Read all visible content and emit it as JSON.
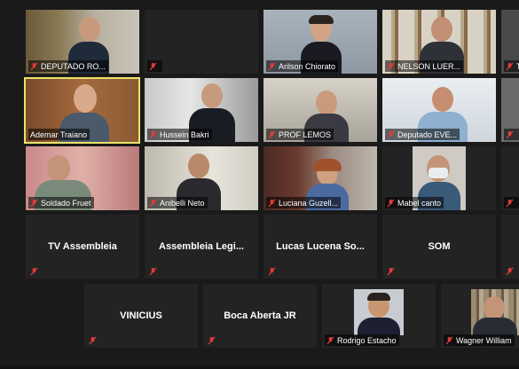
{
  "window": {
    "title": ""
  },
  "icons": {
    "mic": "mic-muted-icon"
  },
  "colors": {
    "active_border": "#e9e36a",
    "muted": "#e23b3b",
    "tile_bg": "#232323"
  },
  "participants": {
    "r1": [
      "DEPUTADO RO...",
      "",
      "Arilson Chiorato",
      "NELSON LUER...",
      "T"
    ],
    "r2": [
      "Ademar Traiano",
      "Hussein Bakri",
      "PROF LEMOS",
      "Deputado EVE...",
      ""
    ],
    "r3": [
      "Soldado Fruet",
      "Anibelli Neto",
      "Luciana Guzell...",
      "Mabel canto",
      ""
    ],
    "r4": [
      "TV Assembleia",
      "Assembleia Legi...",
      "Lucas Lucena So...",
      "SOM",
      ""
    ],
    "r5": [
      "VINICIUS",
      "Boca Aberta JR",
      "Rodrigo Estacho",
      "Wagner William"
    ]
  }
}
